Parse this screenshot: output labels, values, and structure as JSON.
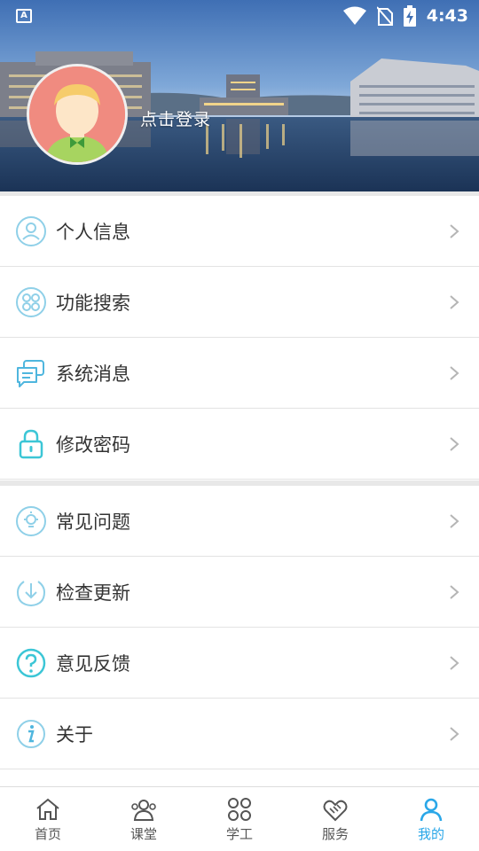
{
  "status_bar": {
    "time": "4:43",
    "app_icon": "a-icon",
    "icons": [
      "wifi-icon",
      "no-sim-icon",
      "battery-charging-icon"
    ]
  },
  "header": {
    "login_label": "点击登录",
    "avatar_icon": "default-avatar-icon"
  },
  "menu_group_1": [
    {
      "label": "个人信息",
      "icon": "user-icon"
    },
    {
      "label": "功能搜索",
      "icon": "grid-icon"
    },
    {
      "label": "系统消息",
      "icon": "message-icon"
    },
    {
      "label": "修改密码",
      "icon": "lock-icon"
    }
  ],
  "menu_group_2": [
    {
      "label": "常见问题",
      "icon": "lightbulb-icon"
    },
    {
      "label": "检查更新",
      "icon": "download-icon"
    },
    {
      "label": "意见反馈",
      "icon": "question-icon"
    },
    {
      "label": "关于",
      "icon": "info-icon"
    }
  ],
  "bottom_nav": [
    {
      "label": "首页",
      "icon": "home-icon",
      "active": false
    },
    {
      "label": "课堂",
      "icon": "classroom-icon",
      "active": false
    },
    {
      "label": "学工",
      "icon": "apps-icon",
      "active": false
    },
    {
      "label": "服务",
      "icon": "service-icon",
      "active": false
    },
    {
      "label": "我的",
      "icon": "profile-icon",
      "active": true
    }
  ],
  "colors": {
    "accent": "#2aa7e8",
    "icon_teal": "#3cc6d6",
    "divider": "#e3e3e3",
    "section_gap": "#e8e8e8"
  }
}
